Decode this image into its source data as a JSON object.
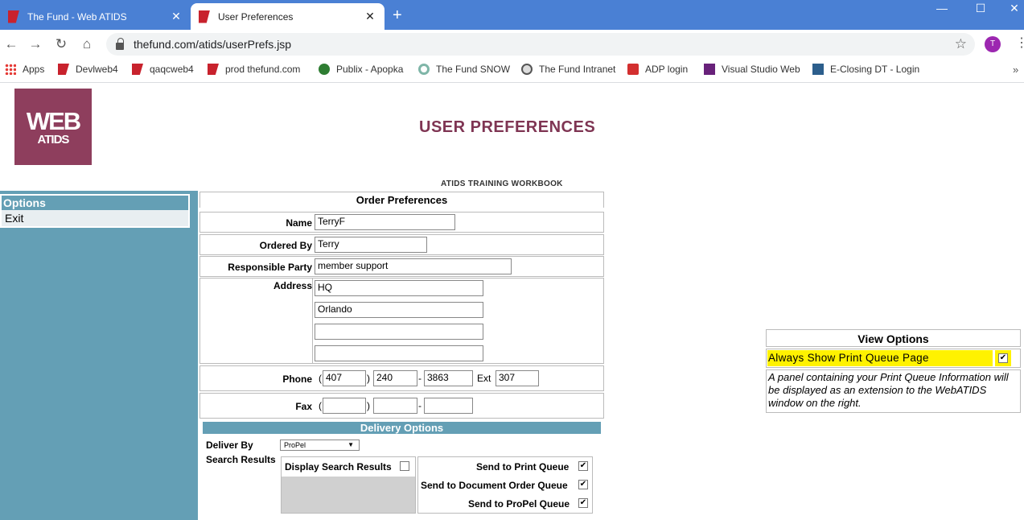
{
  "browser": {
    "tabs": [
      {
        "title": "The Fund - Web ATIDS",
        "active": false
      },
      {
        "title": "User Preferences",
        "active": true
      }
    ],
    "new_tab": "+",
    "url": "thefund.com/atids/userPrefs.jsp",
    "profile_initial": "T",
    "bookmarks": [
      {
        "label": "Apps",
        "icon": "apps"
      },
      {
        "label": "Devlweb4",
        "icon": "red"
      },
      {
        "label": "qaqcweb4",
        "icon": "red"
      },
      {
        "label": "prod thefund.com",
        "icon": "red"
      },
      {
        "label": "Publix - Apopka",
        "icon": "green"
      },
      {
        "label": "The Fund SNOW",
        "icon": "snow"
      },
      {
        "label": "The Fund Intranet",
        "icon": "globe"
      },
      {
        "label": "ADP login",
        "icon": "adp"
      },
      {
        "label": "Visual Studio Web",
        "icon": "vs"
      },
      {
        "label": "E-Closing DT - Login",
        "icon": "ec"
      }
    ]
  },
  "logo": {
    "line1": "WEB",
    "line2": "ATIDS",
    "color": "#8e3e5d"
  },
  "page_title": "USER PREFERENCES",
  "workbook": "ATIDS TRAINING WORKBOOK",
  "sidebar": {
    "header": "Options",
    "items": [
      "Exit"
    ],
    "color": "#649fb5"
  },
  "order": {
    "header": "Order Preferences",
    "name_label": "Name",
    "name": "TerryF",
    "ordered_by_label": "Ordered By",
    "ordered_by": "Terry",
    "responsible_label": "Responsible Party",
    "responsible": "member support",
    "address_label": "Address",
    "address": [
      "HQ",
      "Orlando",
      "",
      ""
    ],
    "phone_label": "Phone",
    "phone": {
      "area": "407",
      "prefix": "240",
      "line": "3863",
      "ext_label": "Ext",
      "ext": "307"
    },
    "fax_label": "Fax",
    "fax": {
      "area": "",
      "prefix": "",
      "line": ""
    }
  },
  "delivery": {
    "header": "Delivery Options",
    "deliver_by_label": "Deliver By",
    "deliver_by": "ProPel",
    "search_results_label": "Search Results",
    "display_search_results": "Display Search Results",
    "send_print": "Send to Print Queue",
    "send_doc": "Send to Document Order Queue",
    "send_propel": "Send to ProPel Queue",
    "check_mark": "✔"
  },
  "view_options": {
    "header": "View Options",
    "always_show": "Always Show Print Queue Page",
    "description": "A panel containing your Print Queue Information will be displayed as an extension to the WebATIDS window on the right."
  }
}
